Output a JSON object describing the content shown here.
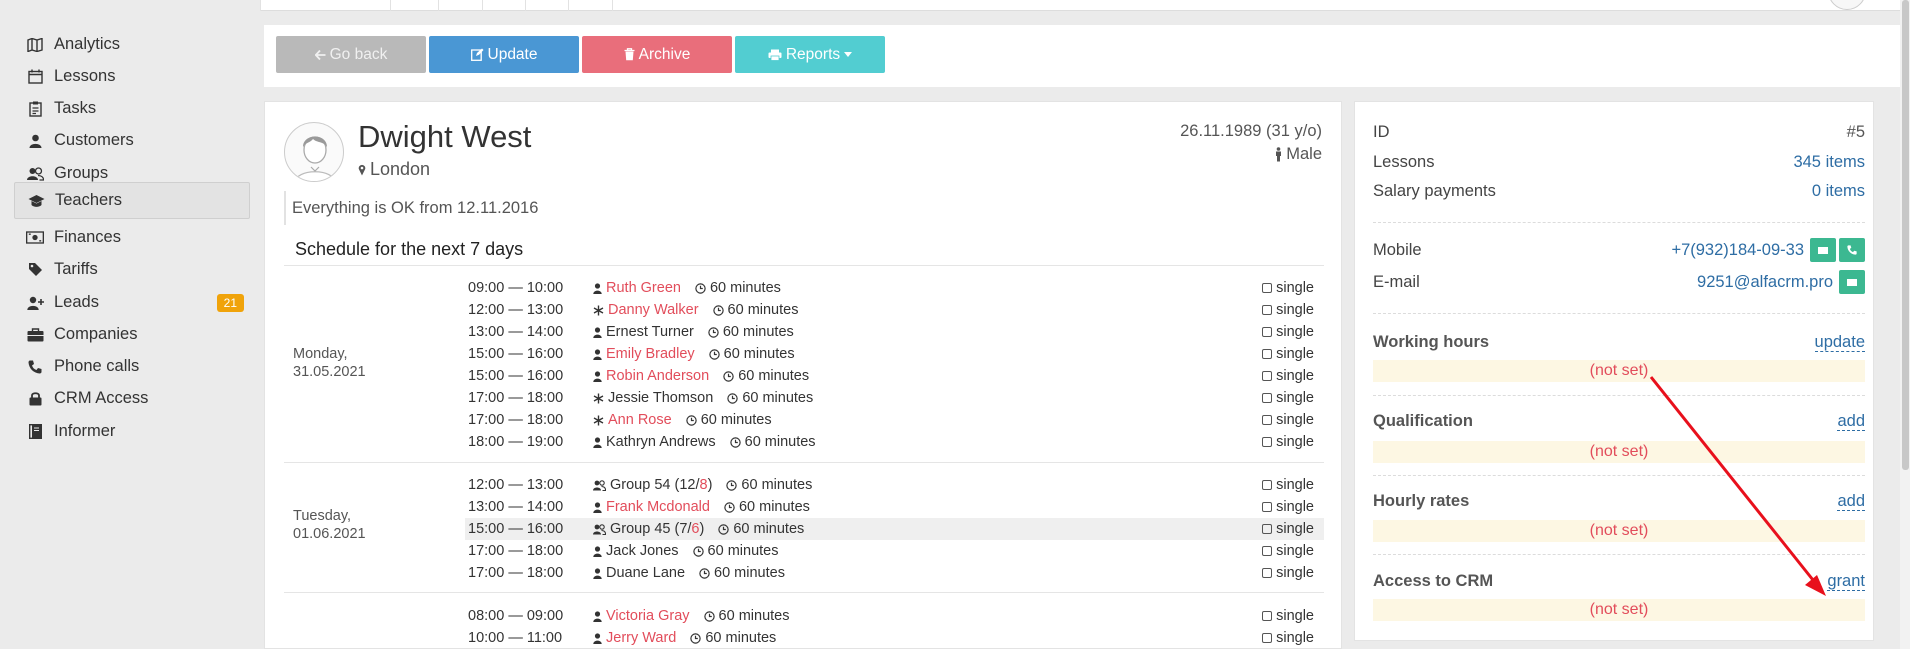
{
  "sidebar": {
    "items": [
      {
        "label": "Analytics",
        "icon": "map-icon"
      },
      {
        "label": "Lessons",
        "icon": "calendar-icon"
      },
      {
        "label": "Tasks",
        "icon": "clipboard-icon"
      },
      {
        "label": "Customers",
        "icon": "user-icon"
      },
      {
        "label": "Groups",
        "icon": "users-icon"
      },
      {
        "label": "Teachers",
        "icon": "graduation-cap-icon",
        "active": true
      },
      {
        "label": "Finances",
        "icon": "money-icon"
      },
      {
        "label": "Tariffs",
        "icon": "tag-icon"
      },
      {
        "label": "Leads",
        "icon": "user-plus-icon",
        "badge": "21"
      },
      {
        "label": "Companies",
        "icon": "briefcase-icon"
      },
      {
        "label": "Phone calls",
        "icon": "phone-icon"
      },
      {
        "label": "CRM Access",
        "icon": "lock-icon"
      },
      {
        "label": "Informer",
        "icon": "book-icon"
      }
    ]
  },
  "toolbar": {
    "back_label": "Go back",
    "update_label": "Update",
    "archive_label": "Archive",
    "reports_label": "Reports"
  },
  "profile": {
    "name": "Dwight West",
    "city": "London",
    "dob": "26.11.1989 (31 y/o)",
    "gender": "Male",
    "status": "Everything is OK from 12.11.2016"
  },
  "schedule": {
    "title": "Schedule for the next 7 days",
    "days": [
      {
        "label_line1": "Monday,",
        "label_line2": "31.05.2021",
        "rows": [
          {
            "time": "09:00 — 10:00",
            "name": "Ruth Green",
            "kind": "user",
            "red": true,
            "duration": "60 minutes",
            "type": "single"
          },
          {
            "time": "12:00 — 13:00",
            "name": "Danny Walker",
            "kind": "trial",
            "red": true,
            "duration": "60 minutes",
            "type": "single"
          },
          {
            "time": "13:00 — 14:00",
            "name": "Ernest Turner",
            "kind": "user",
            "red": false,
            "duration": "60 minutes",
            "type": "single"
          },
          {
            "time": "15:00 — 16:00",
            "name": "Emily Bradley",
            "kind": "user",
            "red": true,
            "duration": "60 minutes",
            "type": "single"
          },
          {
            "time": "15:00 — 16:00",
            "name": "Robin Anderson",
            "kind": "user",
            "red": true,
            "duration": "60 minutes",
            "type": "single"
          },
          {
            "time": "17:00 — 18:00",
            "name": "Jessie Thomson",
            "kind": "trial",
            "red": false,
            "duration": "60 minutes",
            "type": "single"
          },
          {
            "time": "17:00 — 18:00",
            "name": "Ann Rose",
            "kind": "trial",
            "red": true,
            "duration": "60 minutes",
            "type": "single"
          },
          {
            "time": "18:00 — 19:00",
            "name": "Kathryn Andrews",
            "kind": "user",
            "red": false,
            "duration": "60 minutes",
            "type": "single"
          }
        ]
      },
      {
        "label_line1": "Tuesday,",
        "label_line2": "01.06.2021",
        "rows": [
          {
            "time": "12:00 — 13:00",
            "name": "Group 54 (12/",
            "name_red_part": "8",
            "name_tail": ")",
            "kind": "group",
            "red": false,
            "duration": "60 minutes",
            "type": "single"
          },
          {
            "time": "13:00 — 14:00",
            "name": "Frank Mcdonald",
            "kind": "user",
            "red": true,
            "duration": "60 minutes",
            "type": "single"
          },
          {
            "time": "15:00 — 16:00",
            "name": "Group 45 (7/",
            "name_red_part": "6",
            "name_tail": ")",
            "kind": "group",
            "red": false,
            "duration": "60 minutes",
            "type": "single",
            "highlight": true
          },
          {
            "time": "17:00 — 18:00",
            "name": "Jack Jones",
            "kind": "user",
            "red": false,
            "duration": "60 minutes",
            "type": "single"
          },
          {
            "time": "17:00 — 18:00",
            "name": "Duane Lane",
            "kind": "user",
            "red": false,
            "duration": "60 minutes",
            "type": "single"
          }
        ]
      },
      {
        "label_line1": "",
        "label_line2": "",
        "rows": [
          {
            "time": "08:00 — 09:00",
            "name": "Victoria Gray",
            "kind": "user",
            "red": true,
            "duration": "60 minutes",
            "type": "single"
          },
          {
            "time": "10:00 — 11:00",
            "name": "Jerry Ward",
            "kind": "user",
            "red": true,
            "duration": "60 minutes",
            "type": "single"
          }
        ]
      }
    ]
  },
  "panel": {
    "id_label": "ID",
    "id_value": "#5",
    "lessons_label": "Lessons",
    "lessons_value": "345 items",
    "salary_label": "Salary payments",
    "salary_value": "0 items",
    "mobile_label": "Mobile",
    "mobile_value": "+7(932)184-09-33",
    "email_label": "E-mail",
    "email_value": "9251@alfacrm.pro",
    "sections": [
      {
        "title": "Working hours",
        "action": "update",
        "value": "(not set)"
      },
      {
        "title": "Qualification",
        "action": "add",
        "value": "(not set)"
      },
      {
        "title": "Hourly rates",
        "action": "add",
        "value": "(not set)"
      },
      {
        "title": "Access to CRM",
        "action": "grant",
        "value": "(not set)"
      }
    ]
  },
  "colors": {
    "accent_blue": "#4a97d4",
    "danger": "#e96e7b",
    "teal": "#52cdd1",
    "green": "#3cb891",
    "annotation_arrow": "#e8101c"
  }
}
